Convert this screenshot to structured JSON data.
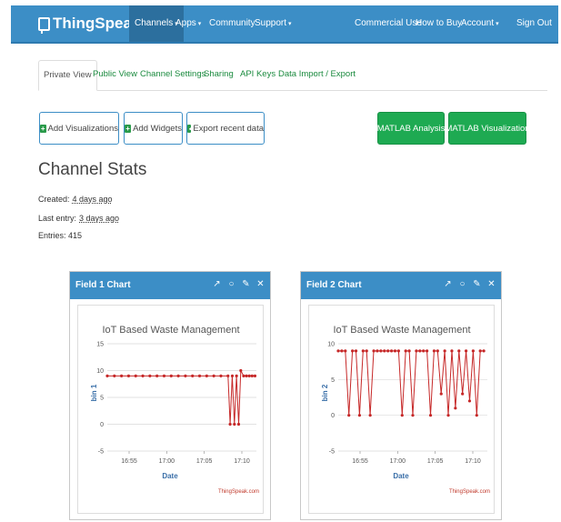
{
  "navbar": {
    "brand": "ThingSpeak",
    "brand_tm": "™",
    "items": [
      {
        "label": "Channels",
        "caret": "▾"
      },
      {
        "label": "Apps",
        "caret": "▾"
      },
      {
        "label": "Community",
        "caret": ""
      },
      {
        "label": "Support",
        "caret": "▾"
      },
      {
        "label": "Commercial Use",
        "caret": ""
      },
      {
        "label": "How to Buy",
        "caret": ""
      },
      {
        "label": "Account",
        "caret": "▾"
      },
      {
        "label": "Sign Out",
        "caret": ""
      }
    ]
  },
  "tabs": [
    "Private View",
    "Public View",
    "Channel Settings",
    "Sharing",
    "API Keys",
    "Data Import / Export"
  ],
  "actions": {
    "add_visualizations": "Add Visualizations",
    "add_widgets": "Add Widgets",
    "export_data": "Export recent data",
    "matlab_analysis": "MATLAB Analysis",
    "matlab_visualization": "MATLAB Visualization"
  },
  "stats": {
    "title": "Channel Stats",
    "created_label": "Created:",
    "created_value": "4 days ago",
    "last_entry_label": "Last entry:",
    "last_entry_value": "3 days ago",
    "entries_label": "Entries:",
    "entries_value": "415"
  },
  "colors": {
    "navbar": "#3c8ec6",
    "accent_green": "#1eaa52",
    "series": "#c62828"
  },
  "chart_data": [
    {
      "type": "line",
      "panel_title": "Field 1 Chart",
      "title": "IoT Based Waste Management",
      "xlabel": "Date",
      "ylabel": "bin 1",
      "credit": "ThingSpeak.com",
      "ylim": [
        -5,
        15
      ],
      "yticks": [
        15,
        10,
        5,
        0,
        -5
      ],
      "xticks": [
        "16:55",
        "17:00",
        "17:05",
        "17:10"
      ],
      "xlim_minutes": [
        -8,
        13
      ],
      "series": [
        {
          "x": [
            -8,
            -7,
            -6,
            -5,
            -4,
            -3,
            -2,
            -1,
            0,
            1,
            2,
            3,
            4,
            5,
            6,
            7,
            8,
            9,
            9.3,
            9.6,
            9.9,
            10.2,
            10.5,
            10.8,
            11.2,
            11.6,
            12,
            12.4,
            12.8
          ],
          "y": [
            9,
            9,
            9,
            9,
            9,
            9,
            9,
            9,
            9,
            9,
            9,
            9,
            9,
            9,
            9,
            9,
            9,
            9,
            0,
            9,
            0,
            9,
            0,
            10,
            9,
            9,
            9,
            9,
            9
          ]
        }
      ]
    },
    {
      "type": "line",
      "panel_title": "Field 2 Chart",
      "title": "IoT Based Waste Management",
      "xlabel": "Date",
      "ylabel": "bin 2",
      "credit": "ThingSpeak.com",
      "ylim": [
        -5,
        10
      ],
      "yticks": [
        10,
        5,
        0,
        -5
      ],
      "xticks": [
        "16:55",
        "17:00",
        "17:05",
        "17:10"
      ],
      "xlim_minutes": [
        -8,
        13
      ],
      "series": [
        {
          "x": [
            -8,
            -7.5,
            -7,
            -6.5,
            -6,
            -5.5,
            -5,
            -4.5,
            -4,
            -3.5,
            -3,
            -2.5,
            -2,
            -1.5,
            -1,
            -0.5,
            0,
            0.5,
            1,
            1.5,
            2,
            2.5,
            3,
            3.5,
            4,
            4.5,
            5,
            5.5,
            6,
            6.5,
            7,
            7.5,
            8,
            8.5,
            9,
            9.5,
            10,
            10.5,
            11,
            11.5,
            12,
            12.5
          ],
          "y": [
            9,
            9,
            9,
            0,
            9,
            9,
            0,
            9,
            9,
            0,
            9,
            9,
            9,
            9,
            9,
            9,
            9,
            9,
            0,
            9,
            9,
            0,
            9,
            9,
            9,
            9,
            0,
            9,
            9,
            3,
            9,
            0,
            9,
            1,
            9,
            3,
            9,
            2,
            9,
            0,
            9,
            9
          ]
        }
      ]
    }
  ]
}
